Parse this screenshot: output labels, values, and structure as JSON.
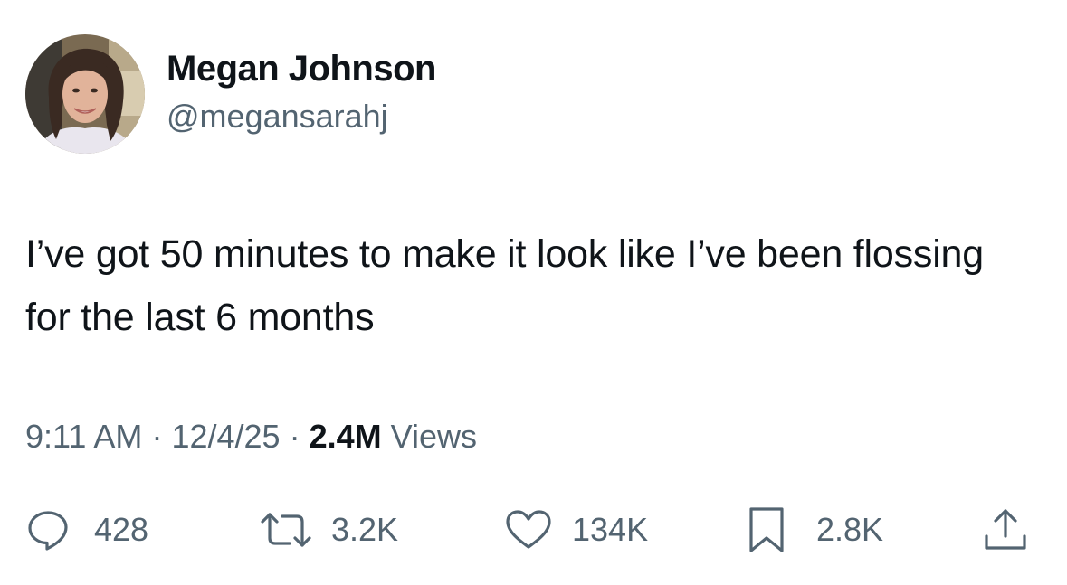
{
  "author": {
    "display_name": "Megan Johnson",
    "handle": "@megansarahj",
    "avatar_icon": "profile-photo"
  },
  "tweet": {
    "text": "I’ve got 50 minutes to make it look like I’ve been flossing for the last 6 months"
  },
  "meta": {
    "time": "9:11 AM",
    "separator": "·",
    "date": "12/4/25",
    "views_count": "2.4M",
    "views_label": "Views"
  },
  "actions": {
    "replies": "428",
    "reposts": "3.2K",
    "likes": "134K",
    "bookmarks": "2.8K"
  },
  "colors": {
    "text_primary": "#0f1419",
    "text_secondary": "#536471",
    "background": "#ffffff"
  }
}
